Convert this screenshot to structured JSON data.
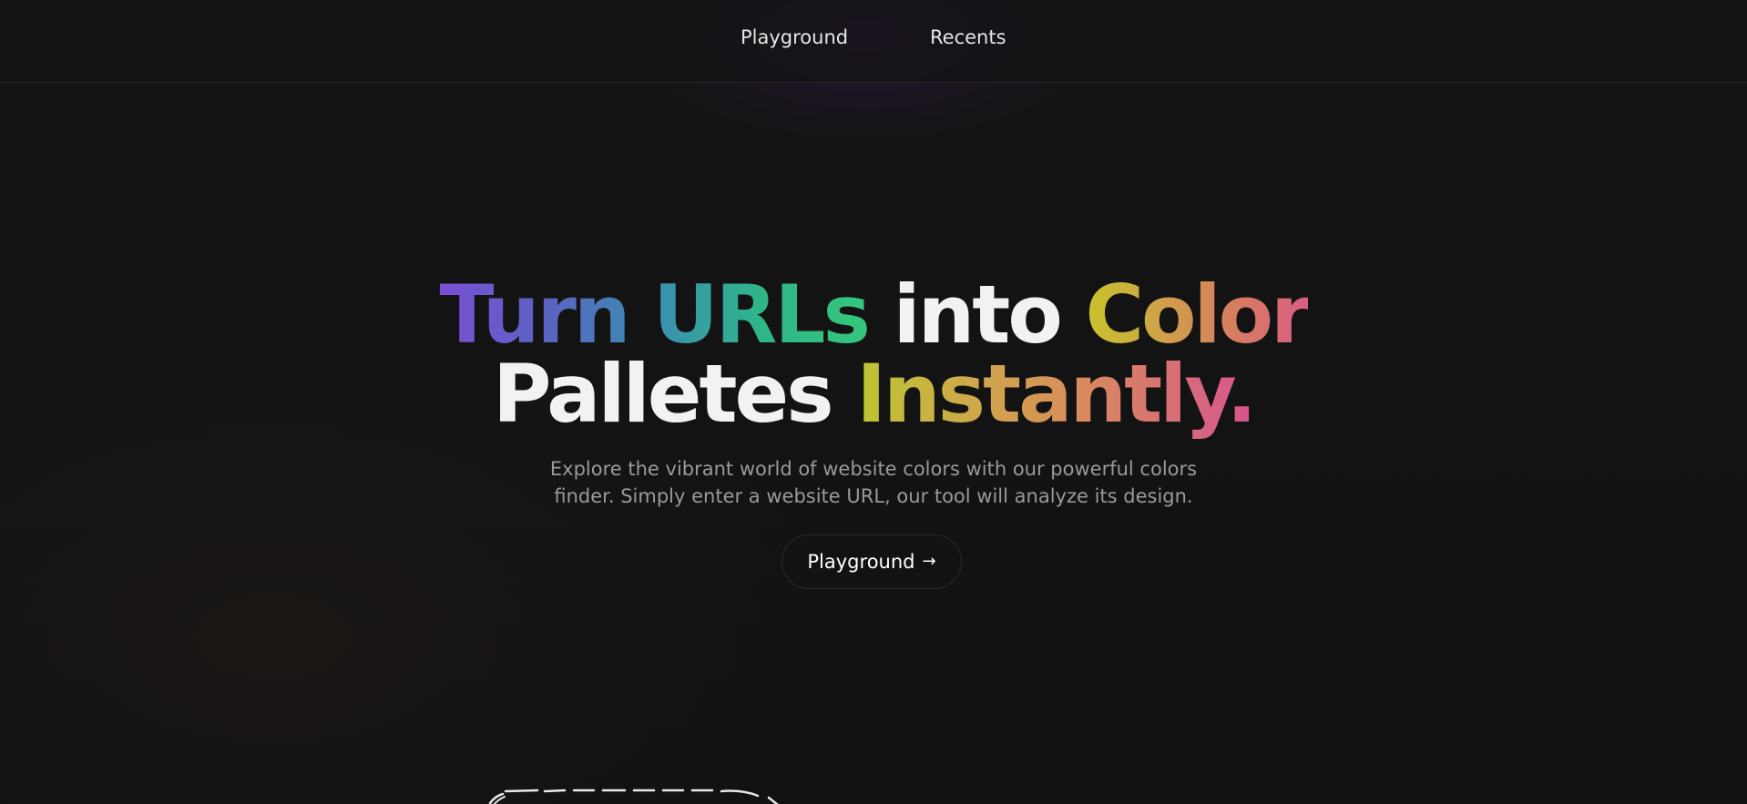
{
  "nav": {
    "links": [
      {
        "label": "Playground"
      },
      {
        "label": "Recents"
      }
    ]
  },
  "hero": {
    "line1": {
      "part1": "Turn URLs",
      "part2": "into",
      "part3": "Color"
    },
    "line2": {
      "part1": "Palletes",
      "part2": "Instantly."
    },
    "subtitle_line1": "Explore the vibrant world of website colors with our powerful colors",
    "subtitle_line2": "finder. Simply enter a website URL, our tool will analyze its design."
  },
  "cta": {
    "label": "Playground",
    "icon": "arrow-right-icon"
  },
  "colors": {
    "background": "#121212",
    "nav_text": "#e6e6e6",
    "subtitle_text": "#9a9a9a",
    "gradient_purple": "#7b4fd4",
    "gradient_green": "#34c77a",
    "gradient_yellow": "#c7c42b",
    "gradient_pink": "#d85390"
  }
}
